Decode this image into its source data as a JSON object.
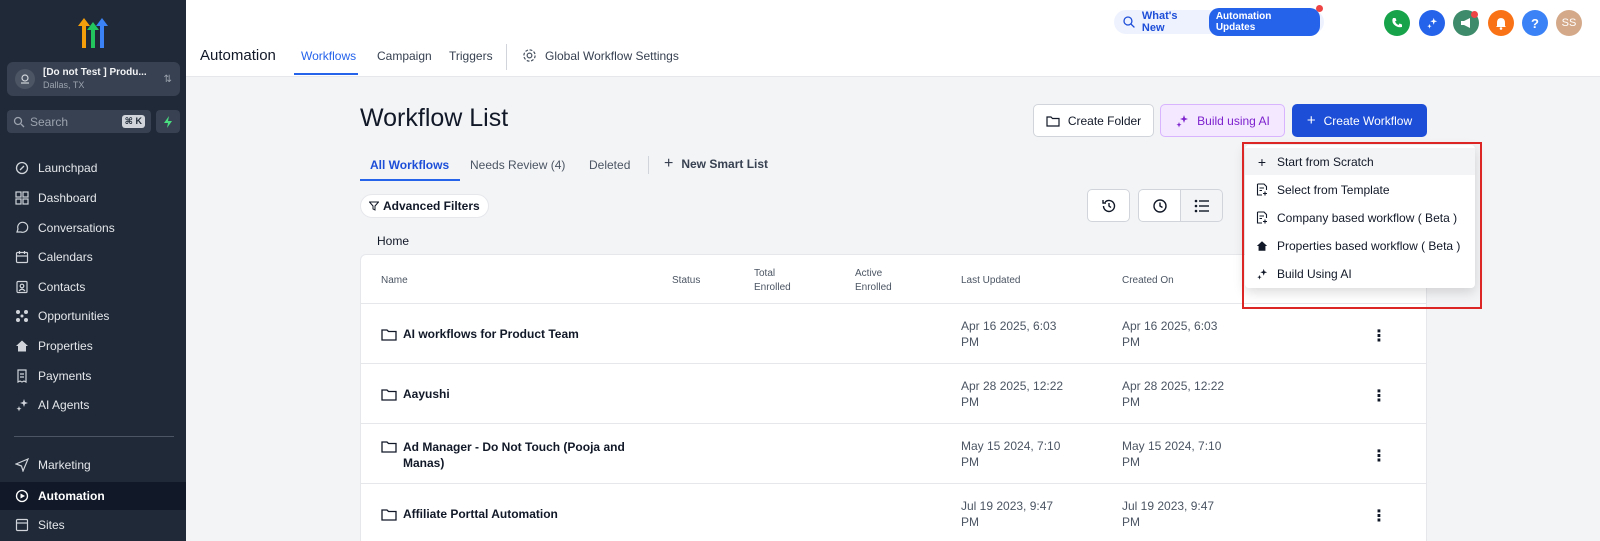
{
  "sidebar": {
    "account": {
      "name": "[Do not Test ] Produ...",
      "location": "Dallas, TX"
    },
    "search": {
      "placeholder": "Search",
      "shortcut": "⌘ K"
    },
    "items": [
      {
        "label": "Launchpad",
        "icon": "rocket-icon"
      },
      {
        "label": "Dashboard",
        "icon": "grid-icon"
      },
      {
        "label": "Conversations",
        "icon": "chat-icon"
      },
      {
        "label": "Calendars",
        "icon": "calendar-icon"
      },
      {
        "label": "Contacts",
        "icon": "contact-icon"
      },
      {
        "label": "Opportunities",
        "icon": "network-icon"
      },
      {
        "label": "Properties",
        "icon": "home-icon"
      },
      {
        "label": "Payments",
        "icon": "receipt-icon"
      },
      {
        "label": "AI Agents",
        "icon": "sparkle-icon"
      },
      {
        "label": "Marketing",
        "icon": "send-icon"
      },
      {
        "label": "Automation",
        "icon": "automation-icon"
      },
      {
        "label": "Sites",
        "icon": "site-icon"
      }
    ]
  },
  "header": {
    "whats_new": "What's New",
    "updates_badge": "Automation Updates",
    "avatar_initials": "SS",
    "help_glyph": "?",
    "page_title": "Automation",
    "tabs": [
      "Workflows",
      "Campaign",
      "Triggers",
      "Global Workflow Settings"
    ]
  },
  "main": {
    "title": "Workflow List",
    "buttons": {
      "create_folder": "Create Folder",
      "build_ai": "Build using AI",
      "create_workflow": "Create Workflow"
    },
    "subtabs": [
      "All Workflows",
      "Needs Review (4)",
      "Deleted",
      "New Smart List"
    ],
    "advanced_filters": "Advanced Filters",
    "breadcrumb": "Home",
    "columns": {
      "name": "Name",
      "status": "Status",
      "total_enrolled": [
        "Total",
        "Enrolled"
      ],
      "active_enrolled": [
        "Active",
        "Enrolled"
      ],
      "last_updated": "Last Updated",
      "created_on": "Created On"
    },
    "rows": [
      {
        "name": "AI workflows for Product Team",
        "last_updated": [
          "Apr 16 2025, 6:03",
          "PM"
        ],
        "created_on": [
          "Apr 16 2025, 6:03",
          "PM"
        ]
      },
      {
        "name": "Aayushi",
        "last_updated": [
          "Apr 28 2025, 12:22",
          "PM"
        ],
        "created_on": [
          "Apr 28 2025, 12:22",
          "PM"
        ]
      },
      {
        "name": "Ad Manager - Do Not Touch (Pooja and Manas)",
        "last_updated": [
          "May 15 2024, 7:10",
          "PM"
        ],
        "created_on": [
          "May 15 2024, 7:10",
          "PM"
        ]
      },
      {
        "name": "Affiliate Porttal Automation",
        "last_updated": [
          "Jul 19 2023, 9:47",
          "PM"
        ],
        "created_on": [
          "Jul 19 2023, 9:47",
          "PM"
        ]
      }
    ]
  },
  "dropdown": {
    "items": [
      {
        "label": "Start from Scratch",
        "icon": "plus-icon"
      },
      {
        "label": "Select from Template",
        "icon": "template-icon"
      },
      {
        "label": "Company based workflow ( Beta )",
        "icon": "company-icon"
      },
      {
        "label": "Properties based workflow ( Beta )",
        "icon": "home-icon"
      },
      {
        "label": "Build Using AI",
        "icon": "sparkle-icon"
      }
    ]
  },
  "colors": {
    "accent": "#1d4ed8",
    "sidebar_bg": "#1f2937",
    "ai_purple": "#7e22ce",
    "highlight_red": "#dc2626"
  }
}
